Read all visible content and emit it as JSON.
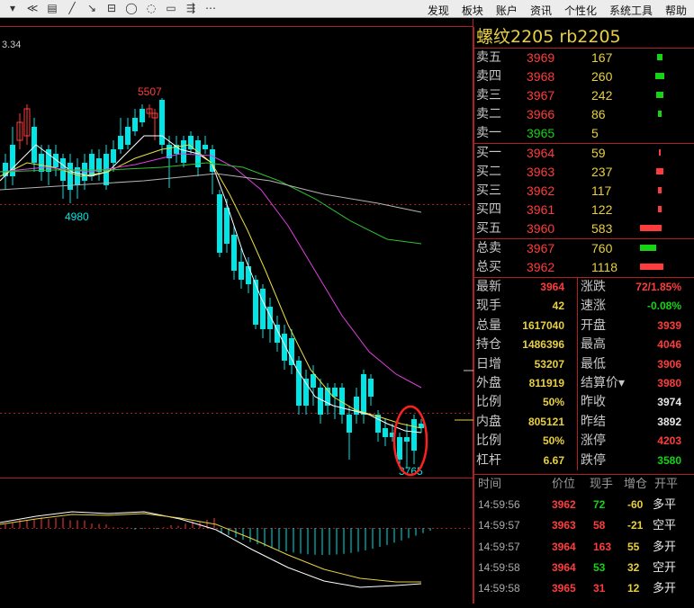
{
  "toolbar": {
    "icons": [
      "▾",
      "≪",
      "▤",
      "╱",
      "↘",
      "⊟",
      "◯",
      "◌",
      "▭",
      "⇶",
      "⋯"
    ],
    "menu": [
      "发现",
      "板块",
      "账户",
      "资讯",
      "个性化",
      "系统工具",
      "帮助"
    ]
  },
  "chart": {
    "corner_label": "3.34",
    "high_label": "5507",
    "low_label": "4980",
    "low2_label": "3765"
  },
  "quote": {
    "title": "螺纹2205  rb2205",
    "asks": [
      {
        "label": "卖五",
        "price": "3969",
        "volume": "167",
        "bar": 0.1
      },
      {
        "label": "卖四",
        "price": "3968",
        "volume": "260",
        "bar": 0.15
      },
      {
        "label": "卖三",
        "price": "3967",
        "volume": "242",
        "bar": 0.14
      },
      {
        "label": "卖二",
        "price": "3966",
        "volume": "86",
        "bar": 0.05
      },
      {
        "label": "卖一",
        "price": "3965",
        "volume": "5",
        "bar": 0.0
      }
    ],
    "bids": [
      {
        "label": "买一",
        "price": "3964",
        "volume": "59",
        "bar": 0.04
      },
      {
        "label": "买二",
        "price": "3963",
        "volume": "237",
        "bar": 0.14
      },
      {
        "label": "买三",
        "price": "3962",
        "volume": "117",
        "bar": 0.07
      },
      {
        "label": "买四",
        "price": "3961",
        "volume": "122",
        "bar": 0.07
      },
      {
        "label": "买五",
        "price": "3960",
        "volume": "583",
        "bar": 0.38
      }
    ],
    "totals": [
      {
        "label": "总卖",
        "price": "3967",
        "volume": "760",
        "bar": 0.28,
        "color": "green"
      },
      {
        "label": "总买",
        "price": "3962",
        "volume": "1118",
        "bar": 0.4,
        "color": "red"
      }
    ],
    "stats": [
      {
        "l1": "最新",
        "v1": "3964",
        "c1": "red",
        "l2": "涨跌",
        "v2": "72/1.85%",
        "c2": "red"
      },
      {
        "l1": "现手",
        "v1": "42",
        "c1": "yellow",
        "l2": "速涨",
        "v2": "-0.08%",
        "c2": "green"
      },
      {
        "l1": "总量",
        "v1": "1617040",
        "c1": "yellow",
        "l2": "开盘",
        "v2": "3939",
        "c2": "red"
      },
      {
        "l1": "持仓",
        "v1": "1486396",
        "c1": "yellow",
        "l2": "最高",
        "v2": "4046",
        "c2": "red"
      },
      {
        "l1": "日增",
        "v1": "53207",
        "c1": "yellow",
        "l2": "最低",
        "v2": "3906",
        "c2": "red"
      },
      {
        "l1": "外盘",
        "v1": "811919",
        "c1": "yellow",
        "l2": "结算价▾",
        "v2": "3980",
        "c2": "red"
      },
      {
        "l1": "比例",
        "v1": "50%",
        "c1": "yellow",
        "l2": "昨收",
        "v2": "3974",
        "c2": "white"
      },
      {
        "l1": "内盘",
        "v1": "805121",
        "c1": "yellow",
        "l2": "昨结",
        "v2": "3892",
        "c2": "white"
      },
      {
        "l1": "比例",
        "v1": "50%",
        "c1": "yellow",
        "l2": "涨停",
        "v2": "4203",
        "c2": "red"
      },
      {
        "l1": "杠杆",
        "v1": "6.67",
        "c1": "yellow",
        "l2": "跌停",
        "v2": "3580",
        "c2": "green"
      }
    ],
    "ticks_header": [
      "时间",
      "价位",
      "现手",
      "增仓",
      "开平"
    ],
    "ticks": [
      {
        "time": "14:59:56",
        "price": "3962",
        "qty": "72",
        "qc": "green",
        "delta": "-60",
        "dc": "yellow",
        "kind": "多平"
      },
      {
        "time": "14:59:57",
        "price": "3963",
        "qty": "58",
        "qc": "red",
        "delta": "-21",
        "dc": "yellow",
        "kind": "空平"
      },
      {
        "time": "14:59:57",
        "price": "3964",
        "qty": "163",
        "qc": "red",
        "delta": "55",
        "dc": "yellow",
        "kind": "多开"
      },
      {
        "time": "14:59:58",
        "price": "3964",
        "qty": "53",
        "qc": "green",
        "delta": "32",
        "dc": "yellow",
        "kind": "空开"
      },
      {
        "time": "14:59:58",
        "price": "3965",
        "qty": "31",
        "qc": "red",
        "delta": "12",
        "dc": "yellow",
        "kind": "多开"
      }
    ]
  },
  "colors": {
    "up": "#ff3c3c",
    "down": "#00e5e5",
    "bg": "#000000",
    "grid": "#b02020",
    "ma5": "#ffffff",
    "ma10": "#e8e040",
    "ma20": "#e040e0",
    "ma60": "#30c030"
  }
}
